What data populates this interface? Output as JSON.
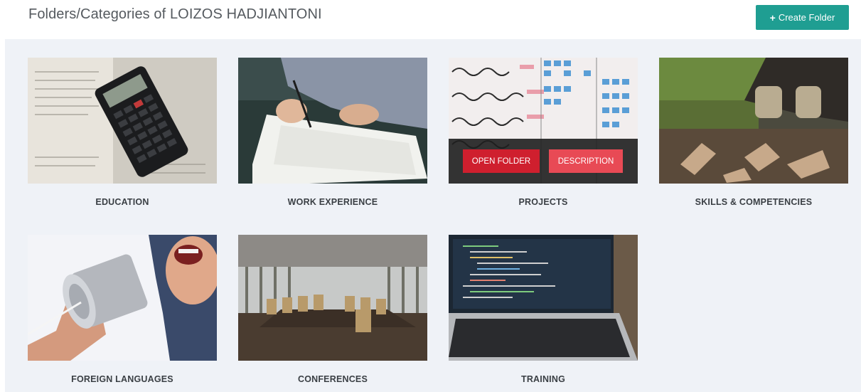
{
  "header": {
    "title": "Folders/Categories of LOIZOS HADJIANTONI",
    "create_button": "Create Folder"
  },
  "folders": [
    {
      "label": "EDUCATION"
    },
    {
      "label": "WORK EXPERIENCE"
    },
    {
      "label": "PROJECTS"
    },
    {
      "label": "SKILLS & COMPETENCIES"
    },
    {
      "label": "FOREIGN LANGUAGES"
    },
    {
      "label": "CONFERENCES"
    },
    {
      "label": "TRAINING"
    }
  ],
  "hover_overlay": {
    "open_label": "OPEN FOLDER",
    "description_label": "DESCRIPTION"
  },
  "colors": {
    "accent": "#1f9e92",
    "panel_bg": "#eff2f7",
    "open_btn": "#cf1f2e",
    "description_btn": "#e84a55"
  }
}
